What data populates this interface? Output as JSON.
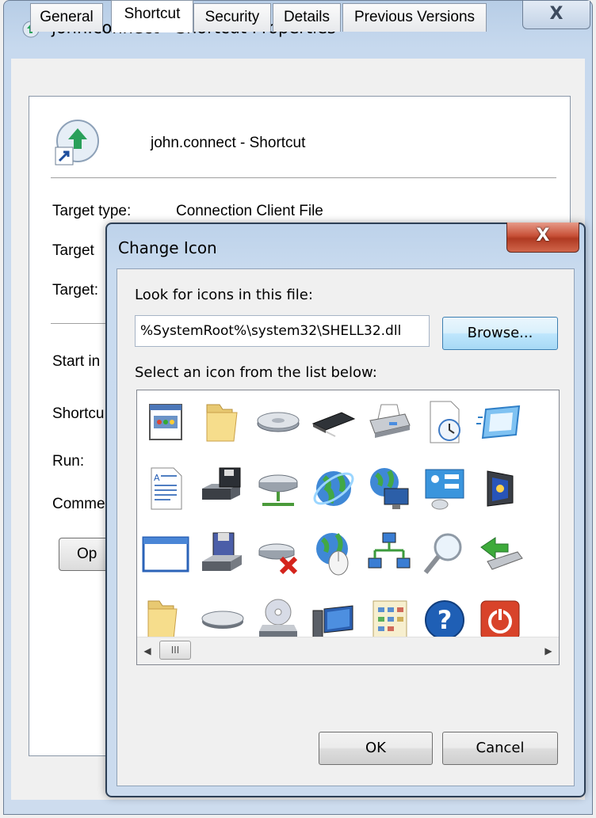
{
  "window": {
    "title": "john.connect - Shortcut Properties",
    "close_glyph": "X"
  },
  "tabs": [
    {
      "label": "General"
    },
    {
      "label": "Shortcut",
      "active": true
    },
    {
      "label": "Security"
    },
    {
      "label": "Details"
    },
    {
      "label": "Previous Versions"
    }
  ],
  "shortcut": {
    "name": "john.connect - Shortcut",
    "target_type_label": "Target type:",
    "target_type_value": "Connection Client File",
    "target_location_label": "Target",
    "target_label": "Target:",
    "start_in_label": "Start in",
    "shortcut_key_label": "Shortcu",
    "run_label": "Run:",
    "comment_label": "Comme",
    "open_button": "Op"
  },
  "dialog": {
    "title": "Change Icon",
    "close_glyph": "X",
    "look_label": "Look for icons in this file:",
    "file_path": "%SystemRoot%\\system32\\SHELL32.dll",
    "browse_button": "Browse...",
    "select_label": "Select an icon from the list below:",
    "scrollbar_thumb_glyph": "III",
    "ok_button": "OK",
    "cancel_button": "Cancel"
  },
  "icons": [
    {
      "row": 0,
      "col": 0,
      "name": "application-window-icon"
    },
    {
      "row": 0,
      "col": 1,
      "name": "folder-icon"
    },
    {
      "row": 0,
      "col": 2,
      "name": "hard-drive-icon"
    },
    {
      "row": 0,
      "col": 3,
      "name": "memory-chip-icon"
    },
    {
      "row": 0,
      "col": 4,
      "name": "printer-icon"
    },
    {
      "row": 0,
      "col": 5,
      "name": "document-clock-icon"
    },
    {
      "row": 0,
      "col": 6,
      "name": "screen-icon"
    },
    {
      "row": 1,
      "col": 0,
      "name": "text-document-icon"
    },
    {
      "row": 1,
      "col": 1,
      "name": "floppy-drive-icon"
    },
    {
      "row": 1,
      "col": 2,
      "name": "network-drive-icon"
    },
    {
      "row": 1,
      "col": 3,
      "name": "internet-globe-icon"
    },
    {
      "row": 1,
      "col": 4,
      "name": "network-globe-monitor-icon"
    },
    {
      "row": 1,
      "col": 5,
      "name": "control-panel-icon"
    },
    {
      "row": 1,
      "col": 6,
      "name": "sleep-monitor-icon"
    },
    {
      "row": 2,
      "col": 0,
      "name": "blank-window-icon"
    },
    {
      "row": 2,
      "col": 1,
      "name": "floppy-disk-drive-icon"
    },
    {
      "row": 2,
      "col": 2,
      "name": "disconnected-drive-icon"
    },
    {
      "row": 2,
      "col": 3,
      "name": "globe-mouse-icon"
    },
    {
      "row": 2,
      "col": 4,
      "name": "network-computers-icon"
    },
    {
      "row": 2,
      "col": 5,
      "name": "magnifier-icon"
    },
    {
      "row": 2,
      "col": 6,
      "name": "usb-arrow-icon"
    },
    {
      "row": 3,
      "col": 0,
      "name": "folder-open-icon"
    },
    {
      "row": 3,
      "col": 1,
      "name": "drive-icon"
    },
    {
      "row": 3,
      "col": 2,
      "name": "cd-drive-icon"
    },
    {
      "row": 3,
      "col": 3,
      "name": "computer-icon"
    },
    {
      "row": 3,
      "col": 4,
      "name": "settings-document-icon"
    },
    {
      "row": 3,
      "col": 5,
      "name": "help-icon"
    },
    {
      "row": 3,
      "col": 6,
      "name": "power-icon"
    }
  ],
  "colors": {
    "dialog_close": "#c85138",
    "browse_accent": "#3c7fb1",
    "help_blue": "#1f5fb5",
    "power_red": "#d8432a"
  }
}
